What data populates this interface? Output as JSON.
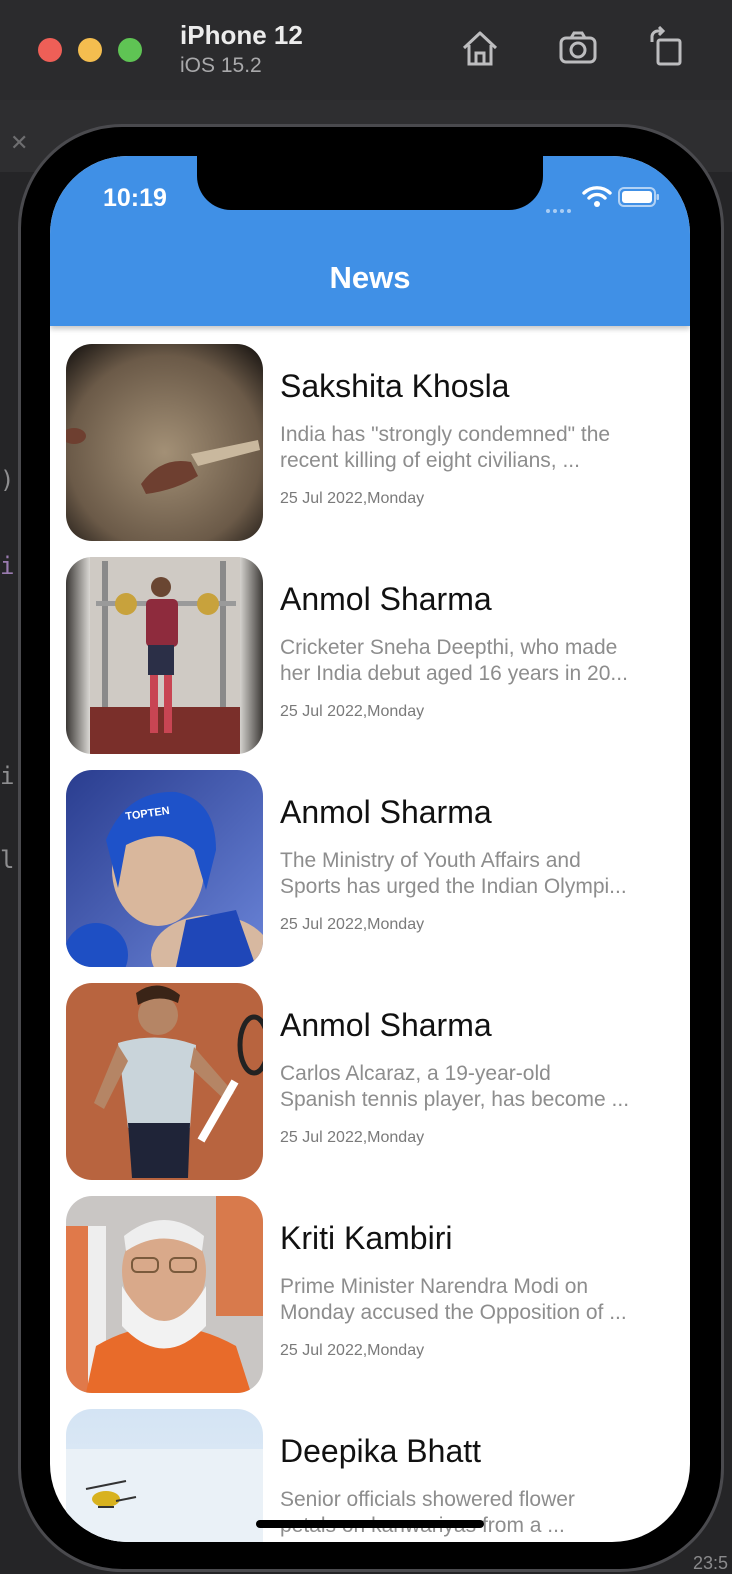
{
  "simulator": {
    "device_name": "iPhone 12",
    "os_version": "iOS 15.2",
    "toolbar_icons": [
      "home-icon",
      "screenshot-icon",
      "rotate-icon"
    ],
    "corner_time": "23:5"
  },
  "status_bar": {
    "time": "10:19"
  },
  "app_bar": {
    "title": "News",
    "color": "#4090e6"
  },
  "news": [
    {
      "author": "Sakshita Khosla",
      "desc_line1": "India has \"strongly condemned\" the",
      "desc_line2": "recent killing of eight civilians, ...",
      "date": "25 Jul 2022,Monday"
    },
    {
      "author": "Anmol Sharma",
      "desc_line1": "Cricketer Sneha Deepthi, who made",
      "desc_line2": "her India debut aged 16 years in 20...",
      "date": "25 Jul 2022,Monday"
    },
    {
      "author": "Anmol Sharma",
      "desc_line1": "The Ministry of Youth Affairs and",
      "desc_line2": "Sports has urged the Indian Olympi...",
      "date": "25 Jul 2022,Monday"
    },
    {
      "author": "Anmol Sharma",
      "desc_line1": "Carlos Alcaraz, a 19-year-old",
      "desc_line2": "Spanish tennis player, has become ...",
      "date": "25 Jul 2022,Monday"
    },
    {
      "author": "Kriti Kambiri",
      "desc_line1": "Prime Minister Narendra Modi on",
      "desc_line2": "Monday accused the Opposition of ...",
      "date": "25 Jul 2022,Monday"
    },
    {
      "author": "Deepika Bhatt",
      "desc_line1": "Senior officials showered flower",
      "desc_line2": "petals on kanwariyas from a ...",
      "date": ""
    }
  ]
}
